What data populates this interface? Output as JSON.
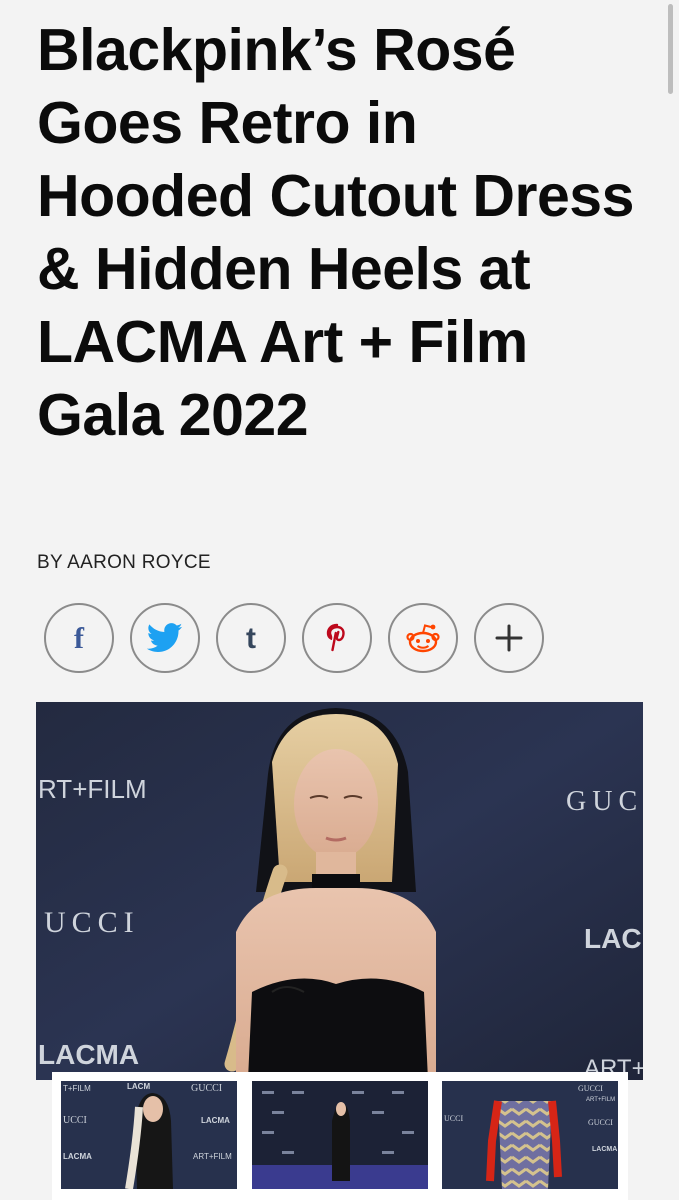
{
  "article": {
    "headline": "Blackpink’s Rosé Goes Retro in Hooded Cutout Dress & Hidden Heels at LACMA Art + Film Gala 2022",
    "byline": "BY AARON ROYCE"
  },
  "share": {
    "buttons": [
      {
        "id": "facebook",
        "glyph": "f",
        "icon": "facebook-icon",
        "color": "#3b5998"
      },
      {
        "id": "twitter",
        "glyph": "",
        "icon": "twitter-icon",
        "color": "#1da1f2"
      },
      {
        "id": "tumblr",
        "glyph": "t",
        "icon": "tumblr-icon",
        "color": "#35465c"
      },
      {
        "id": "pinterest",
        "glyph": "P",
        "icon": "pinterest-icon",
        "color": "#bd081c"
      },
      {
        "id": "reddit",
        "glyph": "",
        "icon": "reddit-icon",
        "color": "#ff4500"
      },
      {
        "id": "more",
        "glyph": "+",
        "icon": "plus-icon",
        "color": "#333333"
      }
    ]
  },
  "hero_image": {
    "watermarks": {
      "art_film": "RT+FILM",
      "gucci_left": "UCCI",
      "gucci_right": "GUC",
      "lacma_right": "LACN",
      "lacma_left": "LACMA",
      "art_film_bottom": "ART+F"
    }
  },
  "thumbnails": [
    {
      "labels": [
        "T+FILM",
        "LACM",
        "GUCCI",
        "UCCI",
        "LACMA",
        "LACMA",
        "ART+FILM"
      ]
    },
    {
      "labels": []
    },
    {
      "labels": [
        "GUCCI",
        "LACMA",
        "ART+FILM",
        "UCCI",
        "GUCCI"
      ]
    }
  ]
}
